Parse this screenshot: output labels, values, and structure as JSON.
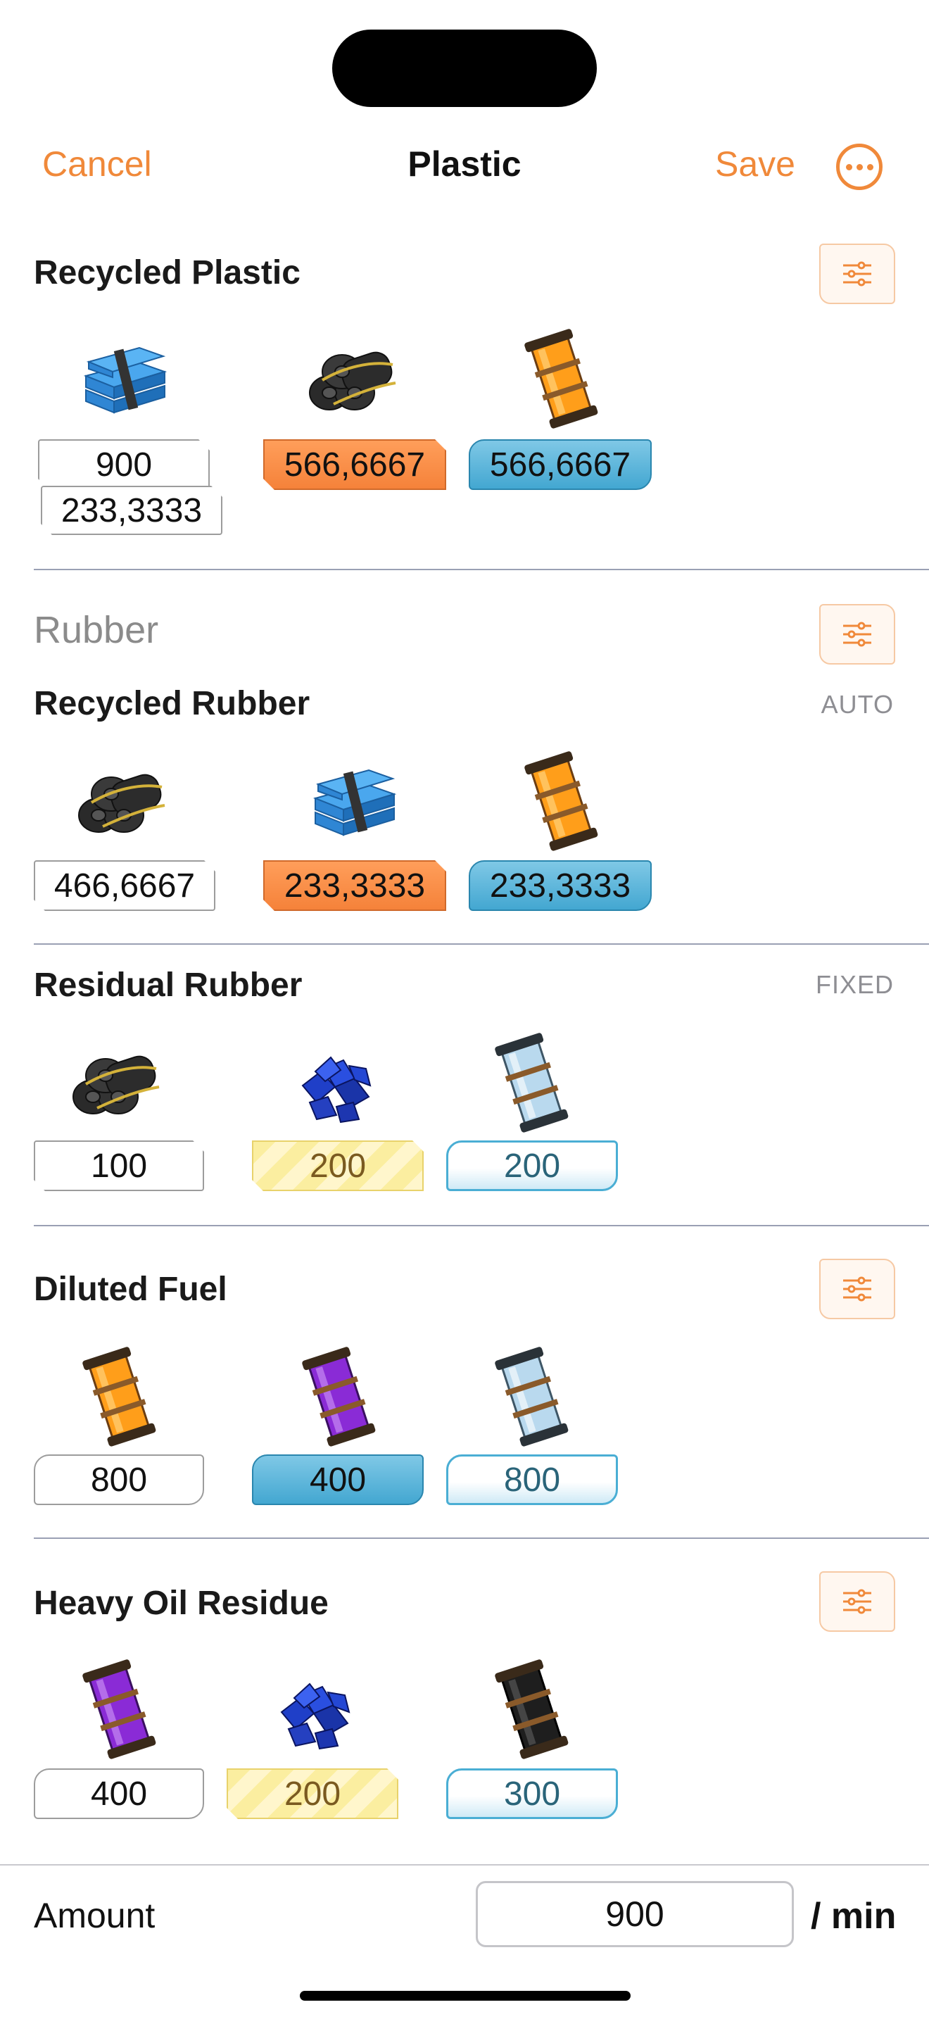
{
  "nav": {
    "cancel": "Cancel",
    "title": "Plastic",
    "save": "Save",
    "more_icon": "ellipsis-circle-icon"
  },
  "colors": {
    "accent": "#f0893a"
  },
  "sections": [
    {
      "title": "Recycled Plastic",
      "badges": [
        "900",
        "233,3333",
        "566,6667",
        "566,6667"
      ]
    },
    {
      "group": "Rubber",
      "title": "Recycled Rubber",
      "tag": "AUTO",
      "badges": [
        "466,6667",
        "233,3333",
        "233,3333"
      ]
    },
    {
      "title": "Residual Rubber",
      "tag": "FIXED",
      "badges": [
        "100",
        "200",
        "200"
      ]
    },
    {
      "title": "Diluted Fuel",
      "badges": [
        "800",
        "400",
        "800"
      ]
    },
    {
      "title": "Heavy Oil Residue",
      "badges": [
        "400",
        "200",
        "300"
      ]
    }
  ],
  "icons": {
    "plastic": "plastic-sheets-icon",
    "rubber": "rubber-rolls-icon",
    "fuel": "fuel-packaged-icon",
    "polymer": "polymer-resin-icon",
    "water": "water-packaged-icon",
    "heavy_oil": "heavy-oil-packaged-icon",
    "oil": "crude-oil-packaged-icon"
  },
  "amount": {
    "label": "Amount",
    "value": "900",
    "unit": "/ min"
  }
}
